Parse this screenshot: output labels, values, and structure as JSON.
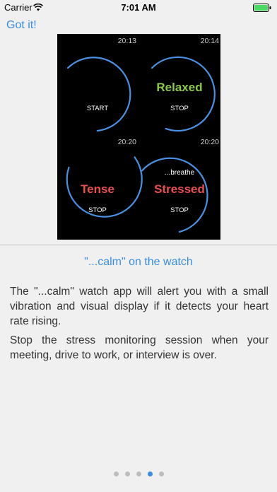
{
  "status_bar": {
    "carrier": "Carrier",
    "time": "7:01 AM"
  },
  "header": {
    "got_it_label": "Got it!"
  },
  "watch": {
    "faces": [
      {
        "time": "20:13",
        "title": "",
        "action": "START"
      },
      {
        "time": "20:14",
        "title": "Relaxed",
        "action": "STOP"
      },
      {
        "time": "20:20",
        "title": "Tense",
        "action": "STOP"
      },
      {
        "time": "20:20",
        "overline": "...breathe",
        "title": "Stressed",
        "action": "STOP"
      }
    ],
    "colors": {
      "ring": "#4a90e2",
      "relaxed": "#8cc84b",
      "tense": "#e9504f",
      "stressed": "#e9504f"
    }
  },
  "content": {
    "title": "\"...calm\" on the watch",
    "paragraph1": "The \"...calm\" watch app will alert you with a small vibration and visual display if it detects your heart rate rising.",
    "paragraph2": "Stop the stress monitoring session when your meeting, drive to work, or interview is over."
  },
  "pager": {
    "count": 5,
    "active_index": 3
  }
}
